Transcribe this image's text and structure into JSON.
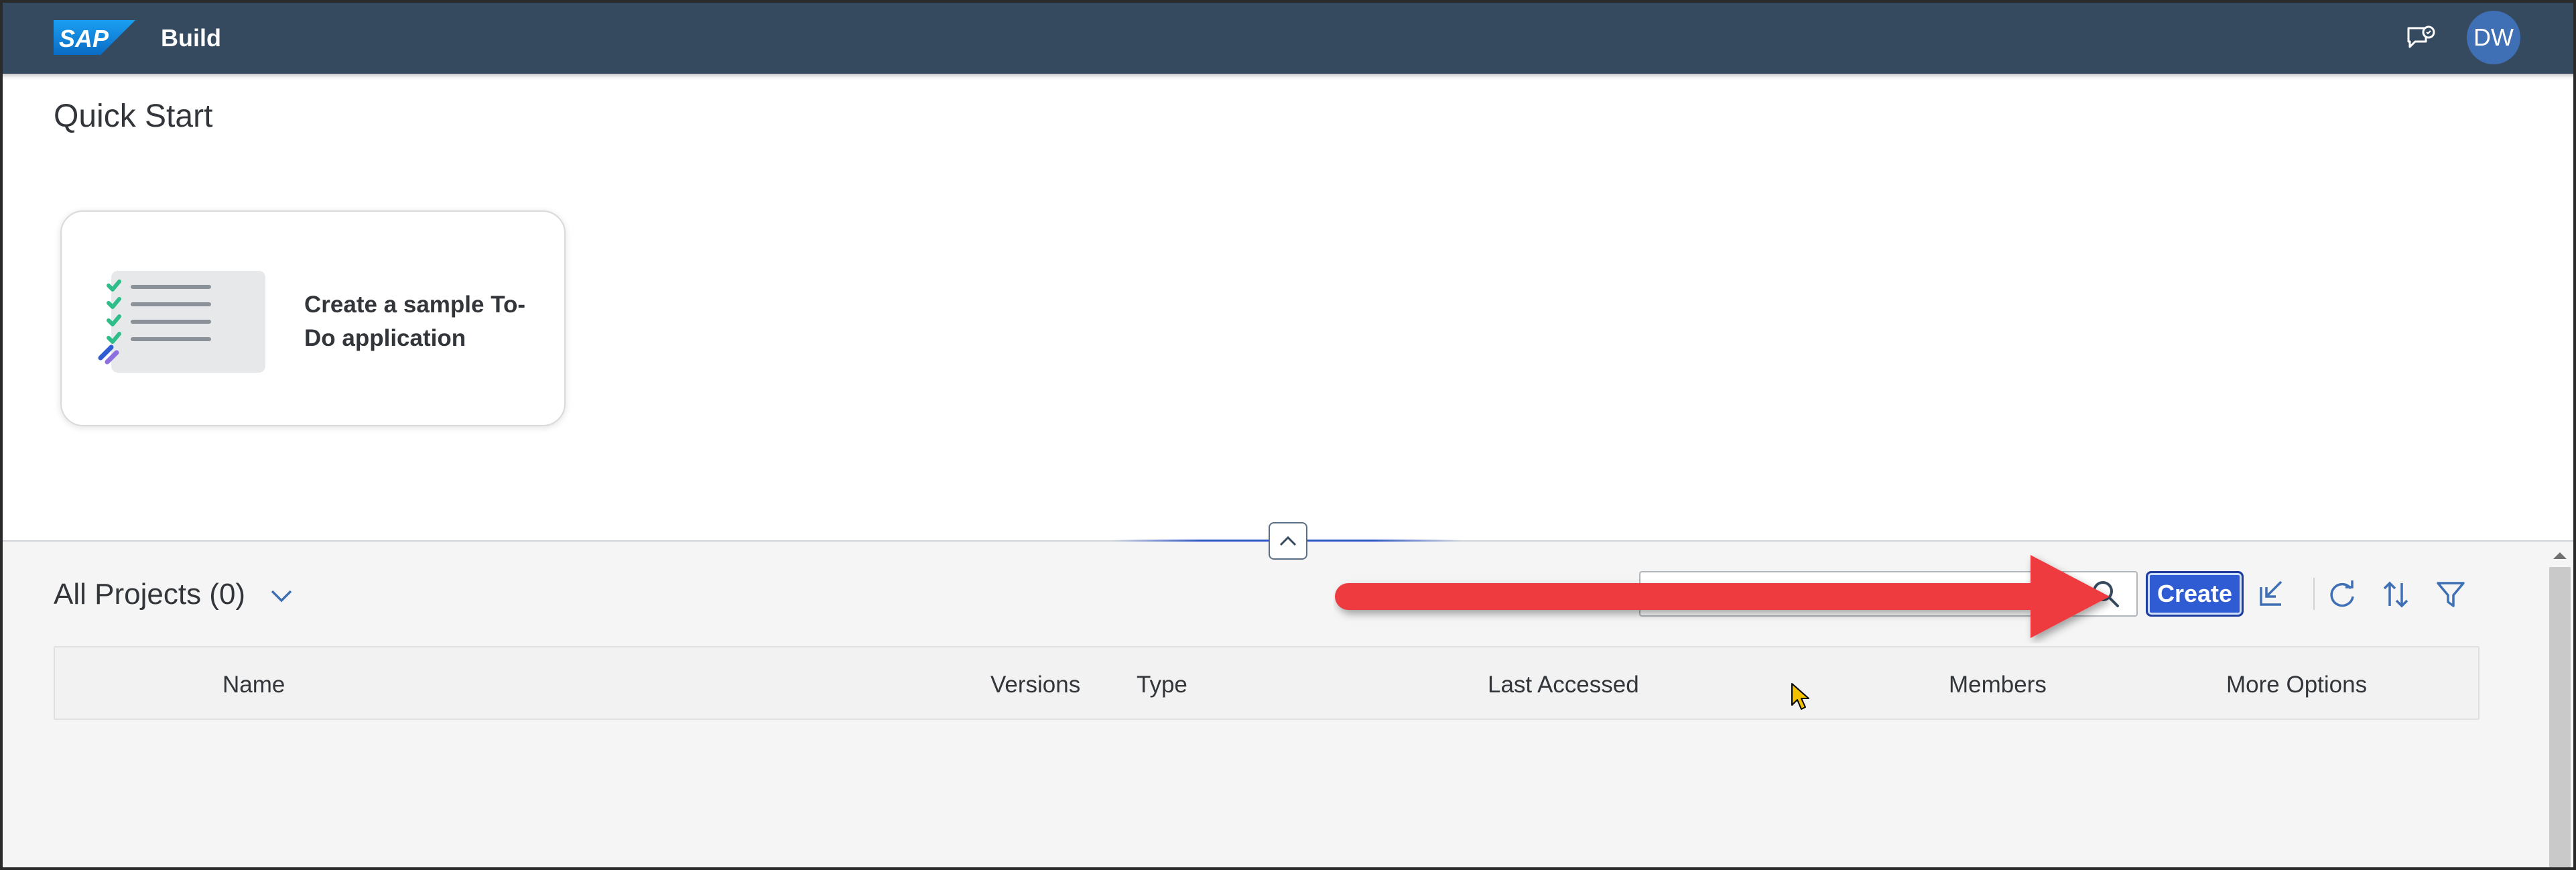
{
  "shellbar": {
    "logo_text": "SAP",
    "title": "Build",
    "feedback_icon": "feedback-icon",
    "avatar_initials": "DW",
    "colors": {
      "background": "#354a5f",
      "avatar": "#3f6fb4"
    }
  },
  "quick_start": {
    "title": "Quick Start",
    "cards": [
      {
        "label": "Create a sample To-Do application",
        "icon": "todo-checklist-illustration"
      }
    ]
  },
  "projects": {
    "title": "All Projects (0)",
    "search": {
      "value": "",
      "placeholder": ""
    },
    "create_label": "Create",
    "toolbar_icons": [
      "import-icon",
      "refresh-icon",
      "sort-icon",
      "filter-icon"
    ],
    "columns": [
      "Name",
      "Versions",
      "Type",
      "Last Accessed",
      "Members",
      "More Options"
    ],
    "rows": []
  },
  "annotation": {
    "type": "arrow",
    "color": "#ee3a3f",
    "points_to": "search-field"
  },
  "colors": {
    "accent": "#2f5bd3",
    "section_bg": "#f5f5f5"
  }
}
